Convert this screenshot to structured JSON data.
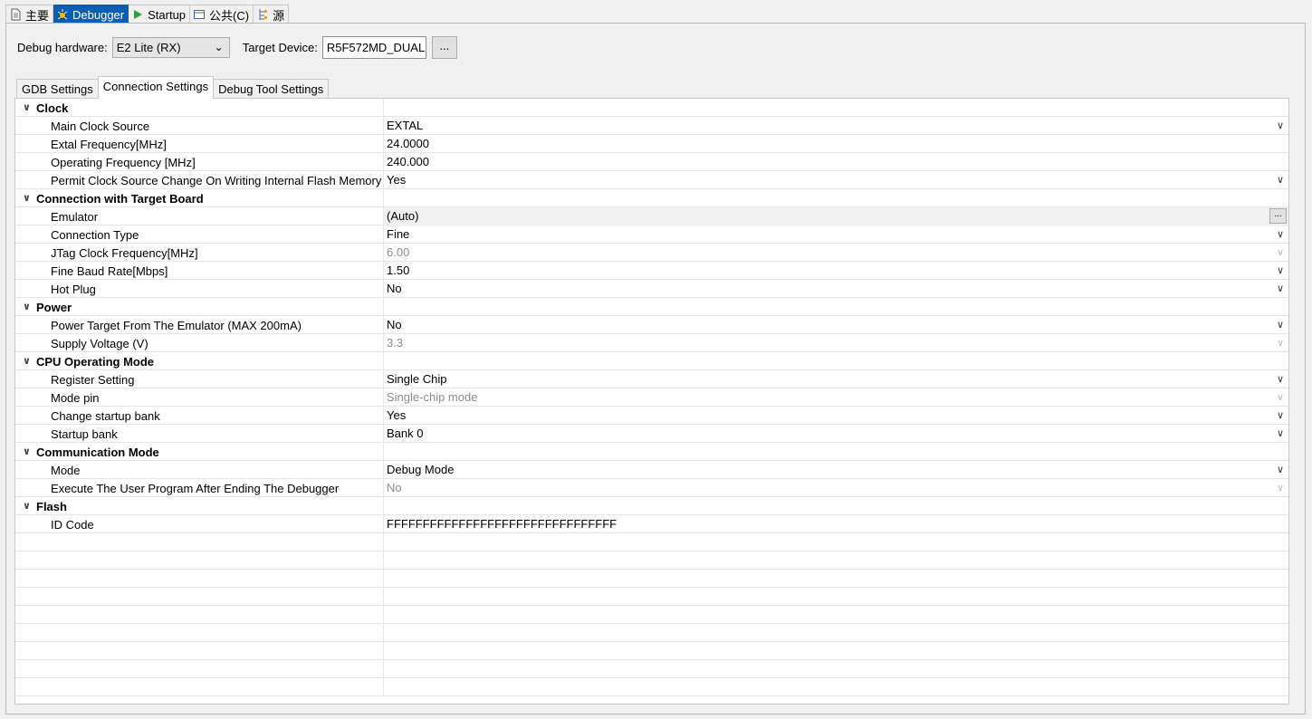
{
  "top_tabs": [
    {
      "label": "主要",
      "icon": "document-icon"
    },
    {
      "label": "Debugger",
      "icon": "bug-icon"
    },
    {
      "label": "Startup",
      "icon": "play-icon"
    },
    {
      "label": "公共(C)",
      "icon": "window-icon"
    },
    {
      "label": "源",
      "icon": "source-icon"
    }
  ],
  "active_top_tab": "Debugger",
  "hardware": {
    "label": "Debug hardware:",
    "value": "E2 Lite (RX)",
    "target_label": "Target Device:",
    "target_value": "R5F572MD_DUAL",
    "browse_label": "..."
  },
  "sub_tabs": [
    "GDB Settings",
    "Connection Settings",
    "Debug Tool Settings"
  ],
  "active_sub_tab": "Connection Settings",
  "table": {
    "categories": [
      {
        "name": "Clock",
        "props": [
          {
            "name": "Main Clock Source",
            "value": "EXTAL",
            "dropdown": true
          },
          {
            "name": "Extal Frequency[MHz]",
            "value": "24.0000"
          },
          {
            "name": "Operating Frequency [MHz]",
            "value": "240.000"
          },
          {
            "name": "Permit Clock Source Change On Writing Internal Flash Memory",
            "value": "Yes",
            "dropdown": true
          }
        ]
      },
      {
        "name": "Connection with Target Board",
        "props": [
          {
            "name": "Emulator",
            "value": "(Auto)",
            "button": "..."
          },
          {
            "name": "Connection Type",
            "value": "Fine",
            "dropdown": true
          },
          {
            "name": "JTag Clock Frequency[MHz]",
            "value": "6.00",
            "dropdown": true,
            "disabled": true
          },
          {
            "name": "Fine Baud Rate[Mbps]",
            "value": "1.50",
            "dropdown": true
          },
          {
            "name": "Hot Plug",
            "value": "No",
            "dropdown": true
          }
        ]
      },
      {
        "name": "Power",
        "props": [
          {
            "name": "Power Target From The Emulator (MAX 200mA)",
            "value": "No",
            "dropdown": true
          },
          {
            "name": "Supply Voltage (V)",
            "value": "3.3",
            "dropdown": true,
            "disabled": true
          }
        ]
      },
      {
        "name": "CPU Operating Mode",
        "props": [
          {
            "name": "Register Setting",
            "value": "Single Chip",
            "dropdown": true
          },
          {
            "name": "Mode pin",
            "value": "Single-chip mode",
            "dropdown": true,
            "disabled": true
          },
          {
            "name": "Change startup bank",
            "value": "Yes",
            "dropdown": true
          },
          {
            "name": "Startup bank",
            "value": "Bank 0",
            "dropdown": true
          }
        ]
      },
      {
        "name": "Communication Mode",
        "props": [
          {
            "name": "Mode",
            "value": "Debug Mode",
            "dropdown": true
          },
          {
            "name": "Execute The User Program After Ending The Debugger",
            "value": "No",
            "dropdown": true,
            "disabled": true
          }
        ]
      },
      {
        "name": "Flash",
        "props": [
          {
            "name": "ID Code",
            "value": "FFFFFFFFFFFFFFFFFFFFFFFFFFFFFFFF"
          }
        ]
      }
    ]
  },
  "colors": {
    "active_tab_bg": "#0a5fb4",
    "panel_bg": "#f0f0f0",
    "disabled_text": "#8c8c8c"
  }
}
